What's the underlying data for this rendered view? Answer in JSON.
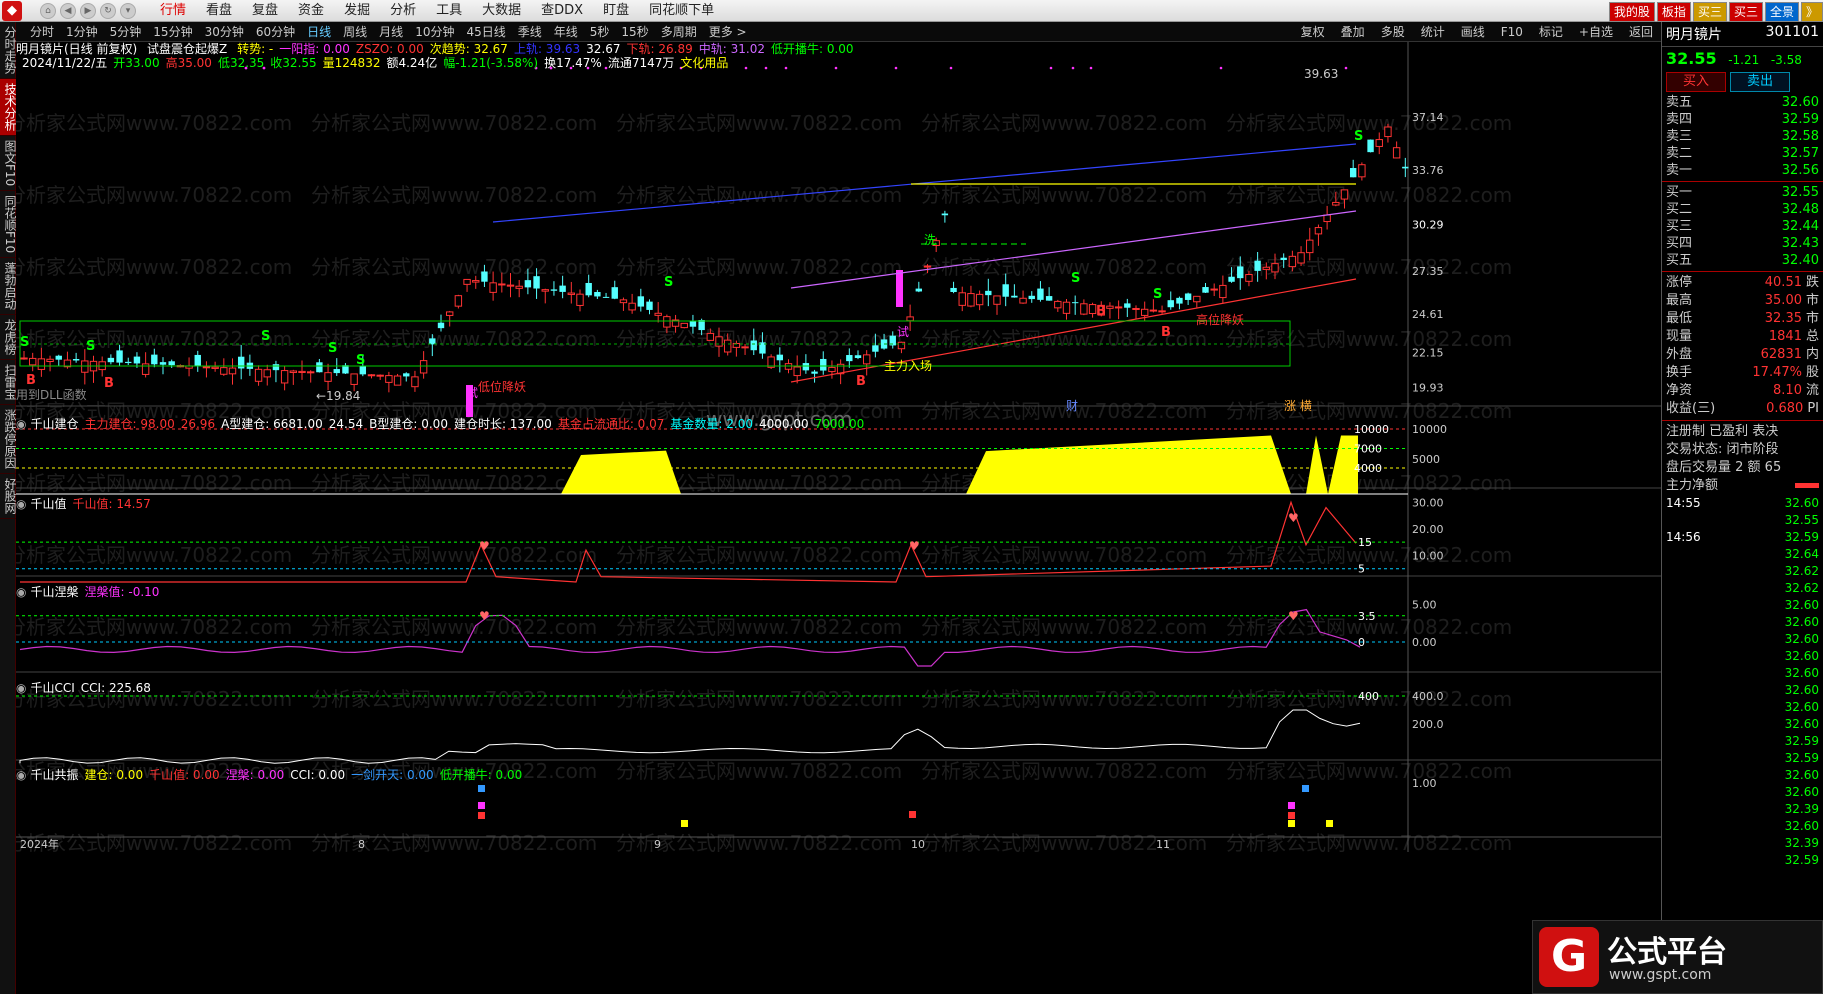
{
  "menubar": {
    "items": [
      "行情",
      "看盘",
      "复盘",
      "资金",
      "发掘",
      "分析",
      "工具",
      "大数据",
      "查DDX",
      "盯盘",
      "同花顺下单"
    ],
    "right_buttons": [
      "我的股",
      "板指",
      "买三",
      "买三",
      "全景",
      "》"
    ]
  },
  "lefttabs": [
    "分时走势",
    "技术分析",
    "图文F10",
    "同花顺F10",
    "蓬勃启动",
    "龙虎榜",
    "扫雷宝",
    "涨跌停原因",
    "好股网"
  ],
  "toolbar": {
    "periods": [
      "分时",
      "1分钟",
      "5分钟",
      "15分钟",
      "30分钟",
      "60分钟",
      "日线",
      "周线",
      "月线",
      "10分钟",
      "45日线",
      "季线",
      "年线",
      "5秒",
      "15秒",
      "多周期",
      "更多 >"
    ],
    "tools": [
      "复权",
      "叠加",
      "多股",
      "统计",
      "画线",
      "F10",
      "标记",
      "+自选",
      "返回"
    ]
  },
  "header": {
    "title": "明月镜片(日线 前复权)",
    "indicator": "试盘震仓起爆Z",
    "line1": [
      {
        "t": "转势: -",
        "c": "#ffff00"
      },
      {
        "t": "一阳指: 0.00",
        "c": "#ff33ff"
      },
      {
        "t": "ZSZO: 0.00",
        "c": "#ff3333"
      },
      {
        "t": "次趋势: 32.67",
        "c": "#ffff00"
      },
      {
        "t": "上轨: 39.63",
        "c": "#3333ff"
      },
      {
        "t": "32.67",
        "c": "#ffffff"
      },
      {
        "t": "下轨: 26.89",
        "c": "#ff3333"
      },
      {
        "t": "中轨: 31.02",
        "c": "#cc66ff"
      },
      {
        "t": "低开播牛: 0.00",
        "c": "#00ff00"
      }
    ],
    "line2": [
      {
        "t": "2024/11/22/五",
        "c": "#ffffff"
      },
      {
        "t": "开33.00",
        "c": "#00ff00"
      },
      {
        "t": "高35.00",
        "c": "#ff3333"
      },
      {
        "t": "低32.35",
        "c": "#00ff00"
      },
      {
        "t": "收32.55",
        "c": "#00ff00"
      },
      {
        "t": "量124832",
        "c": "#ffff00"
      },
      {
        "t": "额4.24亿",
        "c": "#ffffff"
      },
      {
        "t": "幅-1.21(-3.58%)",
        "c": "#00ff00"
      },
      {
        "t": "换17.47%",
        "c": "#ffffff"
      },
      {
        "t": "流通7147万",
        "c": "#ffffff"
      },
      {
        "t": "文化用品",
        "c": "#ffff00"
      }
    ]
  },
  "price_axis": [
    "37.14",
    "33.76",
    "30.29",
    "27.35",
    "24.61",
    "22.15",
    "19.93"
  ],
  "annotations": {
    "high_label": "39.63",
    "low_label": "19.84",
    "dll_note": "用到DLL函数",
    "zhuli": "主力入场",
    "gaowei": "高位降妖",
    "diwei": "低位降妖",
    "cai": "财",
    "zhangting": "涨 横",
    "watermark": "分析家公式网www.70822.com",
    "gspt": "www.gspt.com",
    "shi": "试",
    "xi": "洗"
  },
  "panel1": {
    "title": "千山建仓",
    "items": [
      {
        "t": "主力建仓: 98.00",
        "c": "#ff3333"
      },
      {
        "t": "26.96",
        "c": "#ff3333"
      },
      {
        "t": "A型建仓: 6681.00",
        "c": "#ffffff"
      },
      {
        "t": "24.54",
        "c": "#ffffff"
      },
      {
        "t": "B型建仓: 0.00",
        "c": "#ffffff"
      },
      {
        "t": "建仓时长: 137.00",
        "c": "#ffffff"
      },
      {
        "t": "基金占流通比: 0.07",
        "c": "#ff3333"
      },
      {
        "t": "基金数量: 2.00",
        "c": "#00ffff"
      },
      {
        "t": "4000.00",
        "c": "#ffffff"
      },
      {
        "t": "7000.00",
        "c": "#00ff00"
      }
    ],
    "axis": [
      "10000",
      "5000"
    ],
    "inner_labels": [
      "10000",
      "7000",
      "4000"
    ]
  },
  "panel2": {
    "title": "千山值",
    "items": [
      {
        "t": "千山值: 14.57",
        "c": "#ff3333"
      }
    ],
    "axis": [
      "30.00",
      "20.00",
      "10.00"
    ],
    "inner_labels": [
      "15",
      "5"
    ]
  },
  "panel3": {
    "title": "千山涅槃",
    "items": [
      {
        "t": "涅槃值: -0.10",
        "c": "#ff33ff"
      }
    ],
    "axis": [
      "5.00",
      "0.00"
    ],
    "inner_labels": [
      "3.5",
      "0"
    ]
  },
  "panel4": {
    "title": "千山CCI",
    "items": [
      {
        "t": "CCI: 225.68",
        "c": "#ffffff"
      }
    ],
    "axis": [
      "400.0",
      "200.0"
    ],
    "inner_labels": [
      "400"
    ]
  },
  "panel5": {
    "title": "千山共振",
    "items": [
      {
        "t": "建仓: 0.00",
        "c": "#ffff00"
      },
      {
        "t": "千山值: 0.00",
        "c": "#ff3333"
      },
      {
        "t": "涅槃: 0.00",
        "c": "#ff33ff"
      },
      {
        "t": "CCI: 0.00",
        "c": "#ffffff"
      },
      {
        "t": "一剑开天: 0.00",
        "c": "#3399ff"
      },
      {
        "t": "低开播牛: 0.00",
        "c": "#00ff00"
      }
    ],
    "axis": [
      "1.00"
    ]
  },
  "date_axis": [
    "2024年",
    "8",
    "9",
    "10",
    "11"
  ],
  "right": {
    "name": "明月镜片",
    "code": "301101",
    "price": "32.55",
    "change": "-1.21",
    "pct": "-3.58",
    "buy": "买入",
    "sell": "卖出",
    "asks": [
      [
        "卖五",
        "32.60"
      ],
      [
        "卖四",
        "32.59"
      ],
      [
        "卖三",
        "32.58"
      ],
      [
        "卖二",
        "32.57"
      ],
      [
        "卖一",
        "32.56"
      ]
    ],
    "bids": [
      [
        "买一",
        "32.55"
      ],
      [
        "买二",
        "32.48"
      ],
      [
        "买三",
        "32.44"
      ],
      [
        "买四",
        "32.43"
      ],
      [
        "买五",
        "32.40"
      ]
    ],
    "stats": [
      [
        "涨停",
        "40.51",
        "跌"
      ],
      [
        "最高",
        "35.00",
        "市"
      ],
      [
        "最低",
        "32.35",
        "市"
      ],
      [
        "现量",
        "1841",
        "总"
      ],
      [
        "外盘",
        "62831",
        "内"
      ],
      [
        "换手",
        "17.47%",
        "股"
      ],
      [
        "净资",
        "8.10",
        "流"
      ],
      [
        "收益(三)",
        "0.680",
        "PI"
      ]
    ],
    "notes": [
      "注册制 已盈利 表决",
      "交易状态: 闭市阶段",
      "盘后交易量 2 额 65"
    ],
    "zhuli": "主力净额",
    "ticks": [
      [
        "14:55",
        "32.60"
      ],
      [
        "",
        "32.55"
      ],
      [
        "14:56",
        "32.59"
      ],
      [
        "",
        "32.64"
      ],
      [
        "",
        "32.62"
      ],
      [
        "",
        "32.62"
      ],
      [
        "",
        "32.60"
      ],
      [
        "",
        "32.60"
      ],
      [
        "",
        "32.60"
      ],
      [
        "",
        "32.60"
      ],
      [
        "",
        "32.60"
      ],
      [
        "",
        "32.60"
      ],
      [
        "",
        "32.60"
      ],
      [
        "",
        "32.60"
      ],
      [
        "",
        "32.59"
      ],
      [
        "",
        "32.59"
      ],
      [
        "",
        "32.60"
      ],
      [
        "",
        "32.60"
      ],
      [
        "",
        "32.39"
      ],
      [
        "",
        "32.60"
      ],
      [
        "",
        "32.39"
      ],
      [
        "",
        "32.59"
      ]
    ]
  },
  "badge": {
    "title": "公式平台",
    "url": "www.gspt.com",
    "mark": "G"
  }
}
